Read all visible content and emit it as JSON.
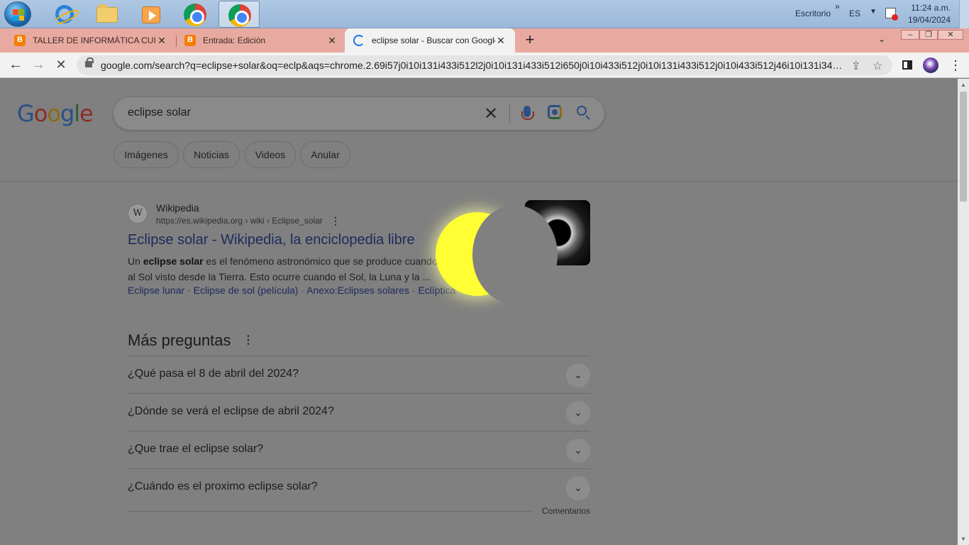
{
  "taskbar": {
    "apps": [
      {
        "name": "Internet Explorer",
        "icon": "ie-icon"
      },
      {
        "name": "Explorador",
        "icon": "folder-icon"
      },
      {
        "name": "Reproductor",
        "icon": "media-icon"
      },
      {
        "name": "Google Chrome",
        "icon": "chrome-icon"
      },
      {
        "name": "Google Chrome (activo)",
        "icon": "chrome-icon"
      }
    ],
    "desktop_label": "Escritorio",
    "expand_glyph": "»",
    "language": "ES",
    "time": "11:24 a.m.",
    "date": "19/04/2024"
  },
  "browser": {
    "tabs": [
      {
        "title": "TALLER DE INFORMÁTICA CUITLA",
        "icon": "blogger-icon"
      },
      {
        "title": "Entrada: Edición",
        "icon": "blogger-icon"
      },
      {
        "title": "eclipse solar - Buscar con Google",
        "icon": "loading-spinner",
        "active": true
      }
    ],
    "new_tab": "+",
    "url": "google.com/search?q=eclipse+solar&oq=eclp&aqs=chrome.2.69i57j0i10i131i433i512l2j0i10i131i433i512i650j0i10i433i512j0i10i131i433i512j0i10i433i512j46i10i131i340..."
  },
  "search": {
    "logo": [
      "G",
      "o",
      "o",
      "g",
      "l",
      "e"
    ],
    "query": "eclipse solar",
    "chips": [
      "Imágenes",
      "Noticias",
      "Videos",
      "Anular"
    ]
  },
  "result": {
    "favicon": "W",
    "site_name": "Wikipedia",
    "site_url": "https://es.wikipedia.org › wiki › Eclipse_solar",
    "title": "Eclipse solar - Wikipedia, la enciclopedia libre",
    "snippet_pre": "Un ",
    "snippet_bold": "eclipse solar",
    "snippet_post": " es el fenómeno astronómico que se produce cuando la Luna oculta al Sol visto desde la Tierra. Esto ocurre cuando el Sol, la Luna y la ...",
    "sublinks": [
      "Eclipse lunar",
      "Eclipse de sol (película)",
      "Anexo:Eclipses solares",
      "Eclíptica"
    ]
  },
  "paa": {
    "title": "Más preguntas",
    "questions": [
      "¿Qué pasa el 8 de abril del 2024?",
      "¿Dónde se verá el eclipse de abril 2024?",
      "¿Que trae el eclipse solar?",
      "¿Cuándo es el proximo eclipse solar?"
    ],
    "feedback": "Comentarios"
  }
}
